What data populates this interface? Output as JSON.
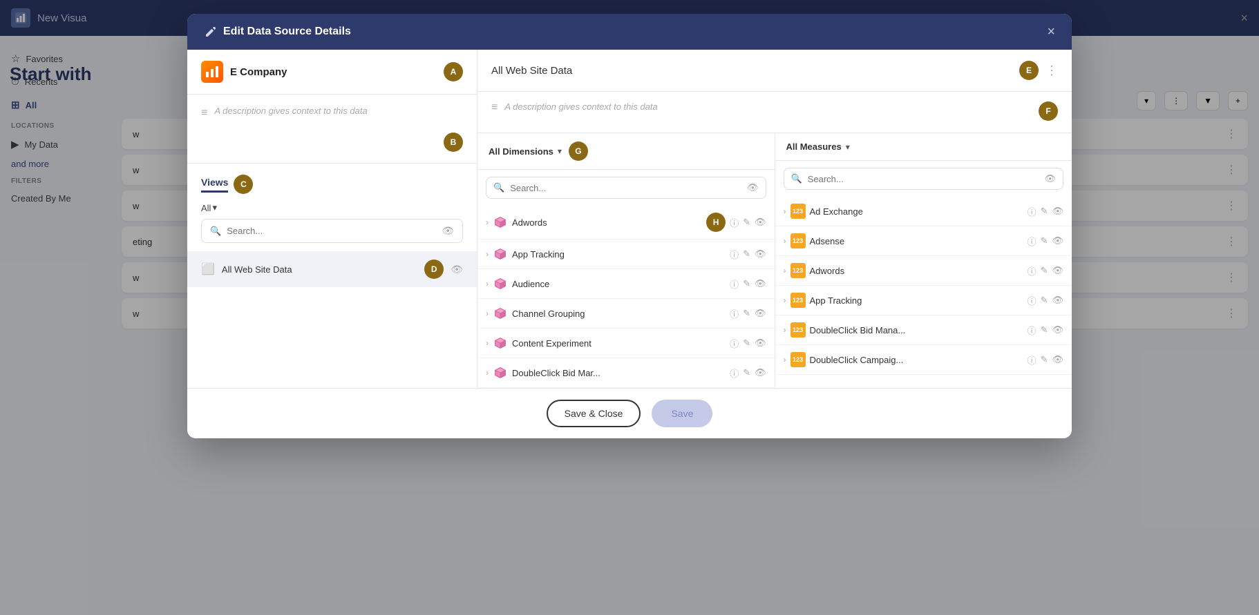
{
  "app": {
    "title": "New Visua",
    "modal_title": "Edit Data Source Details"
  },
  "topbar": {
    "close_label": "×"
  },
  "sidebar": {
    "items": [
      {
        "label": "Favorites",
        "icon": "★"
      },
      {
        "label": "Recents",
        "icon": "🕐"
      },
      {
        "label": "All",
        "icon": "⊞",
        "active": true
      }
    ],
    "locations_label": "LOCATIONS",
    "my_data_label": "My Data",
    "and_more_label": "and more",
    "filters_label": "FILTERS",
    "created_by_me_label": "Created By Me"
  },
  "start_with": {
    "title": "Start with"
  },
  "left_panel": {
    "company_name": "E Company",
    "description_placeholder": "A description gives context to this data",
    "views_tab": "Views",
    "all_filter": "All",
    "search_placeholder": "Search...",
    "view_items": [
      {
        "name": "All Web Site Data"
      }
    ]
  },
  "right_panel": {
    "ds_name": "All Web Site Data",
    "description_placeholder": "A description gives context to this data",
    "dimensions": {
      "title": "All Dimensions",
      "search_placeholder": "Search...",
      "items": [
        {
          "name": "Adwords"
        },
        {
          "name": "App Tracking"
        },
        {
          "name": "Audience"
        },
        {
          "name": "Channel Grouping"
        },
        {
          "name": "Content Experiment"
        },
        {
          "name": "DoubleClick Bid Mar..."
        }
      ]
    },
    "measures": {
      "title": "All Measures",
      "search_placeholder": "Search...",
      "items": [
        {
          "name": "Ad Exchange"
        },
        {
          "name": "Adsense"
        },
        {
          "name": "Adwords"
        },
        {
          "name": "App Tracking"
        },
        {
          "name": "DoubleClick Bid Mana..."
        },
        {
          "name": "DoubleClick Campaig..."
        }
      ]
    }
  },
  "footer": {
    "save_close_label": "Save & Close",
    "save_label": "Save"
  },
  "badges": {
    "A": "A",
    "B": "B",
    "C": "C",
    "D": "D",
    "E": "E",
    "F": "F",
    "G": "G",
    "H": "H"
  },
  "background_items": [
    {
      "name": "w",
      "tag": ""
    },
    {
      "name": "w",
      "tag": ""
    },
    {
      "name": "w",
      "tag": ""
    },
    {
      "name": "eting",
      "tag": ""
    },
    {
      "name": "w",
      "tag": ""
    },
    {
      "name": "w",
      "tag": ""
    }
  ]
}
